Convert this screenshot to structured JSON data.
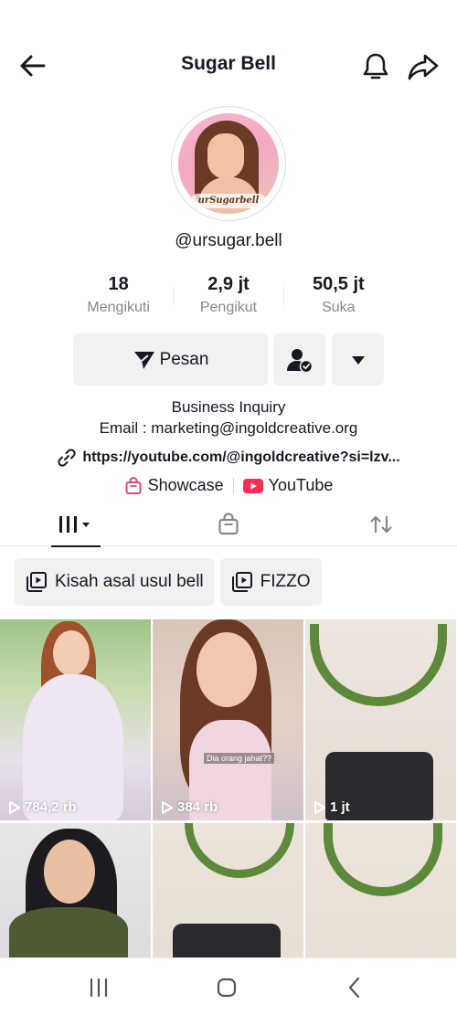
{
  "header": {
    "title": "Sugar Bell",
    "back_icon": "arrow-left-icon",
    "bell_icon": "bell-icon",
    "share_icon": "share-icon"
  },
  "profile": {
    "avatar_tag": "urSugarbell",
    "username": "@ursugar.bell"
  },
  "stats": [
    {
      "value": "18",
      "label": "Mengikuti"
    },
    {
      "value": "2,9 jt",
      "label": "Pengikut"
    },
    {
      "value": "50,5 jt",
      "label": "Suka"
    }
  ],
  "actions": {
    "message_label": "Pesan",
    "message_icon": "send-icon",
    "follow_icon": "user-check-icon",
    "more_icon": "caret-down-icon"
  },
  "bio": {
    "line1": "Business Inquiry",
    "line2": "Email : marketing@ingoldcreative.org",
    "link": "https://youtube.com/@ingoldcreative?si=lzv...",
    "link_icon": "link-icon"
  },
  "chips": {
    "showcase": "Showcase",
    "youtube": "YouTube"
  },
  "tabs": {
    "videos_icon": "grid-icon",
    "shop_icon": "shop-bag-icon",
    "repost_icon": "repost-icon"
  },
  "playlists": [
    {
      "label": "Kisah asal usul bell"
    },
    {
      "label": "FIZZO"
    }
  ],
  "videos": [
    {
      "views": "784,2 rb"
    },
    {
      "views": "384 rb",
      "caption": "Dia orang jahat??"
    },
    {
      "views": "1 jt"
    },
    {
      "views": ""
    },
    {
      "views": ""
    },
    {
      "views": ""
    }
  ],
  "colors": {
    "text": "#161823",
    "muted": "#86878b",
    "button_bg": "#f1f1f2",
    "youtube_red": "#fe2c55",
    "showcase_pink": "#e34a6f"
  }
}
